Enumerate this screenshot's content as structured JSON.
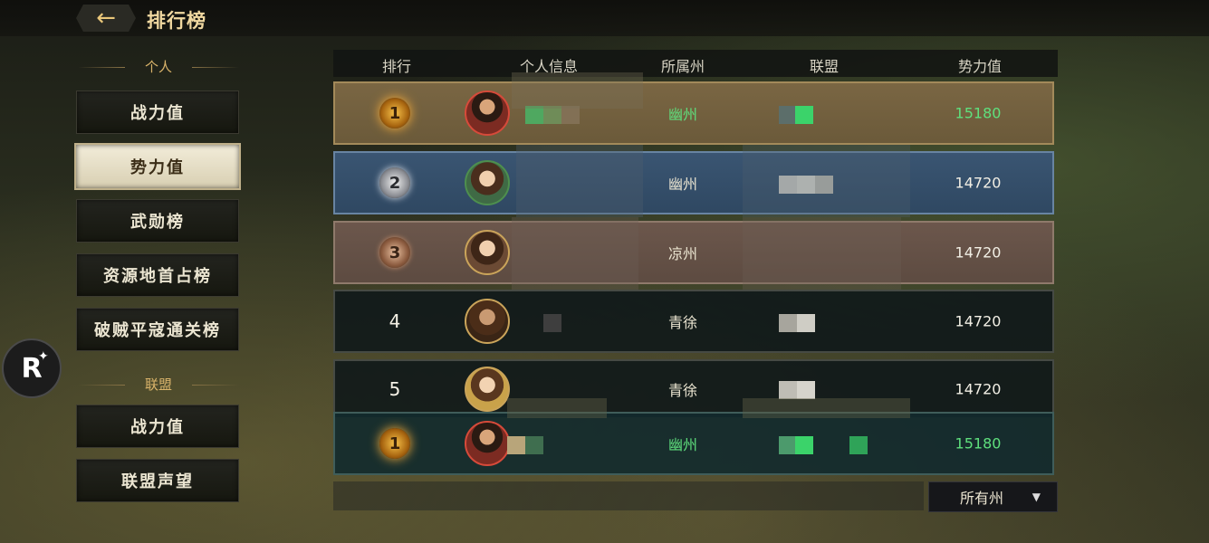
{
  "header": {
    "title": "排行榜",
    "back_icon": "arrow-left-icon"
  },
  "sidebar": {
    "personal_header": "个人",
    "personal_items": [
      {
        "label": "战力值",
        "active": false
      },
      {
        "label": "势力值",
        "active": true
      },
      {
        "label": "武勋榜",
        "active": false
      },
      {
        "label": "资源地首占榜",
        "active": false
      },
      {
        "label": "破贼平寇通关榜",
        "active": false
      }
    ],
    "alliance_header": "联盟",
    "alliance_items": [
      {
        "label": "战力值"
      },
      {
        "label": "联盟声望"
      }
    ]
  },
  "floating_button": {
    "label": "R",
    "icon": "sparkle-icon"
  },
  "table": {
    "columns": [
      "排行",
      "个人信息",
      "所属州",
      "联盟",
      "势力值"
    ],
    "rows": [
      {
        "rank": "1",
        "state": "幽州",
        "power": "15180",
        "highlight": "gold"
      },
      {
        "rank": "2",
        "state": "幽州",
        "power": "14720",
        "highlight": "silver"
      },
      {
        "rank": "3",
        "state": "凉州",
        "power": "14720",
        "highlight": "bronze"
      },
      {
        "rank": "4",
        "state": "青徐",
        "power": "14720",
        "highlight": "none"
      },
      {
        "rank": "5",
        "state": "青徐",
        "power": "14720",
        "highlight": "none"
      }
    ],
    "self_row": {
      "rank": "1",
      "state": "幽州",
      "power": "15180"
    }
  },
  "filter": {
    "selected": "所有州"
  },
  "colors": {
    "accent_green": "#5fe07d",
    "gold": "#d9b36a"
  }
}
